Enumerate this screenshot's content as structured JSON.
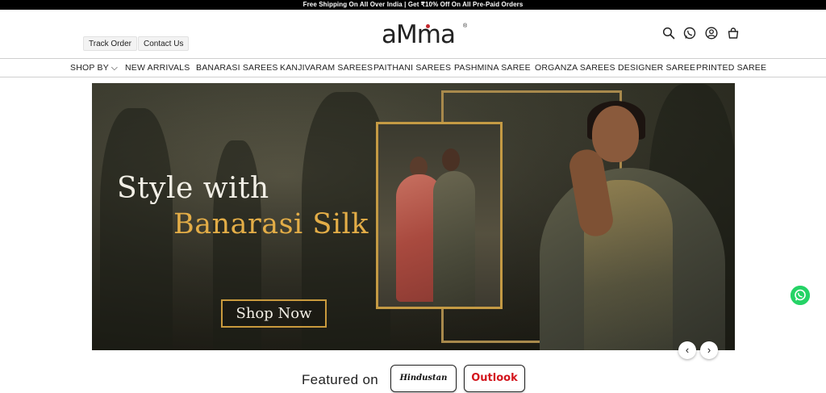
{
  "announcement": {
    "text": "Free Shipping On All Over India | Get ₹10% Off On All Pre-Paid Orders"
  },
  "header": {
    "track_order": "Track Order",
    "contact_us": "Contact Us",
    "logo_text": "aMma",
    "logo_mark": "®",
    "icons": [
      "search-icon",
      "whatsapp-icon",
      "account-icon",
      "cart-icon"
    ]
  },
  "nav": {
    "items": [
      {
        "label": "SHOP BY ⌵"
      },
      {
        "label": "NEW ARRIVALS"
      },
      {
        "label": "BANARASI SAREES"
      },
      {
        "label": "KANJIVARAM SAREES"
      },
      {
        "label": "PAITHANI SAREES"
      },
      {
        "label": "PASHMINA SAREE"
      },
      {
        "label": "ORGANZA SAREES"
      },
      {
        "label": "DESIGNER SAREE"
      },
      {
        "label": "PRINTED SAREE"
      }
    ]
  },
  "banner": {
    "headline_line1": "Style with",
    "headline_line2": "Banarasi Silk",
    "cta": "Shop Now",
    "prev": "‹",
    "next": "›"
  },
  "featured": {
    "label": "Featured on",
    "press": [
      "Hindustan Times",
      "Outlook"
    ]
  },
  "colors": {
    "accent_gold": "#e3ad47",
    "frame_gold": "#c49a44",
    "outlook_red": "#d3141c",
    "whatsapp_green": "#25d366"
  }
}
